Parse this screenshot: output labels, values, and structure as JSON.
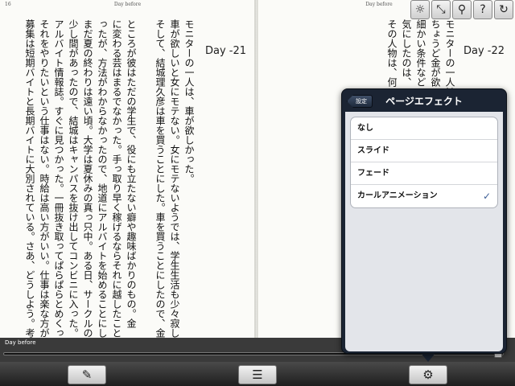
{
  "book": {
    "left_page": {
      "page_number": "16",
      "header_title": "Day before",
      "day_label": "Day -21",
      "text": "モニターの一人は、車が欲しかった。\n車が欲しいと女にモテない。女にモテないようでは、学生生活も少々寂しい。\nそして、結城理久彦は車を買うことにした。車を買うことにしたので、金が必要になった。\n\nところが彼はただの学生で、役にも立たない癖や趣味ばかりのもの。金\nに変わる芸はまるでなかった。手っ取り早く稼げるならそれに越したことはないが、\nったが、方法がわからなかったので、地道にアルバイトを始めることにした。\nまだ夏の終わりは遠い頃。大学は夏休みの真っ只中。ある日、サークルの部室から\n少し間があったので、結城はキャンパスを抜け出してコンビニに入った。探す\nアルバイト情報誌。すぐに見つかった。一冊抜き取ってぱらぱらとめくってい\nそれをやりたいという仕事はない。時給は高い方がいい。仕事は楽な方がい\n募集は短期バイトと長期バイトに大別されている。さあ、どうしよう。考え"
    },
    "right_page": {
      "header_title": "Day before",
      "day_label": "Day -22",
      "text": "モニターの一人は、\nちょうど金が欲\n細かい条件など\n気にしたのは、\nその人物は、何"
    }
  },
  "top_icons": [
    {
      "name": "brightness-icon",
      "glyph": "☼"
    },
    {
      "name": "fullscreen-icon",
      "glyph": "⤡"
    },
    {
      "name": "search-icon",
      "glyph": "⚲"
    },
    {
      "name": "help-icon",
      "glyph": "?"
    },
    {
      "name": "refresh-icon",
      "glyph": "↻"
    }
  ],
  "strip": {
    "label": "Day before",
    "progress": 0.99
  },
  "bottombar": {
    "bookmark_glyph": "✎",
    "toc_glyph": "☰",
    "settings_glyph": "⚙"
  },
  "popover": {
    "back_label": "設定",
    "title": "ページエフェクト",
    "options": [
      {
        "label": "なし",
        "selected": false
      },
      {
        "label": "スライド",
        "selected": false
      },
      {
        "label": "フェード",
        "selected": false
      },
      {
        "label": "カールアニメーション",
        "selected": true
      }
    ],
    "check_glyph": "✓"
  },
  "colors": {
    "popover_bg": "#1b2433",
    "check": "#3d5f96",
    "page": "#fbfbf8"
  }
}
